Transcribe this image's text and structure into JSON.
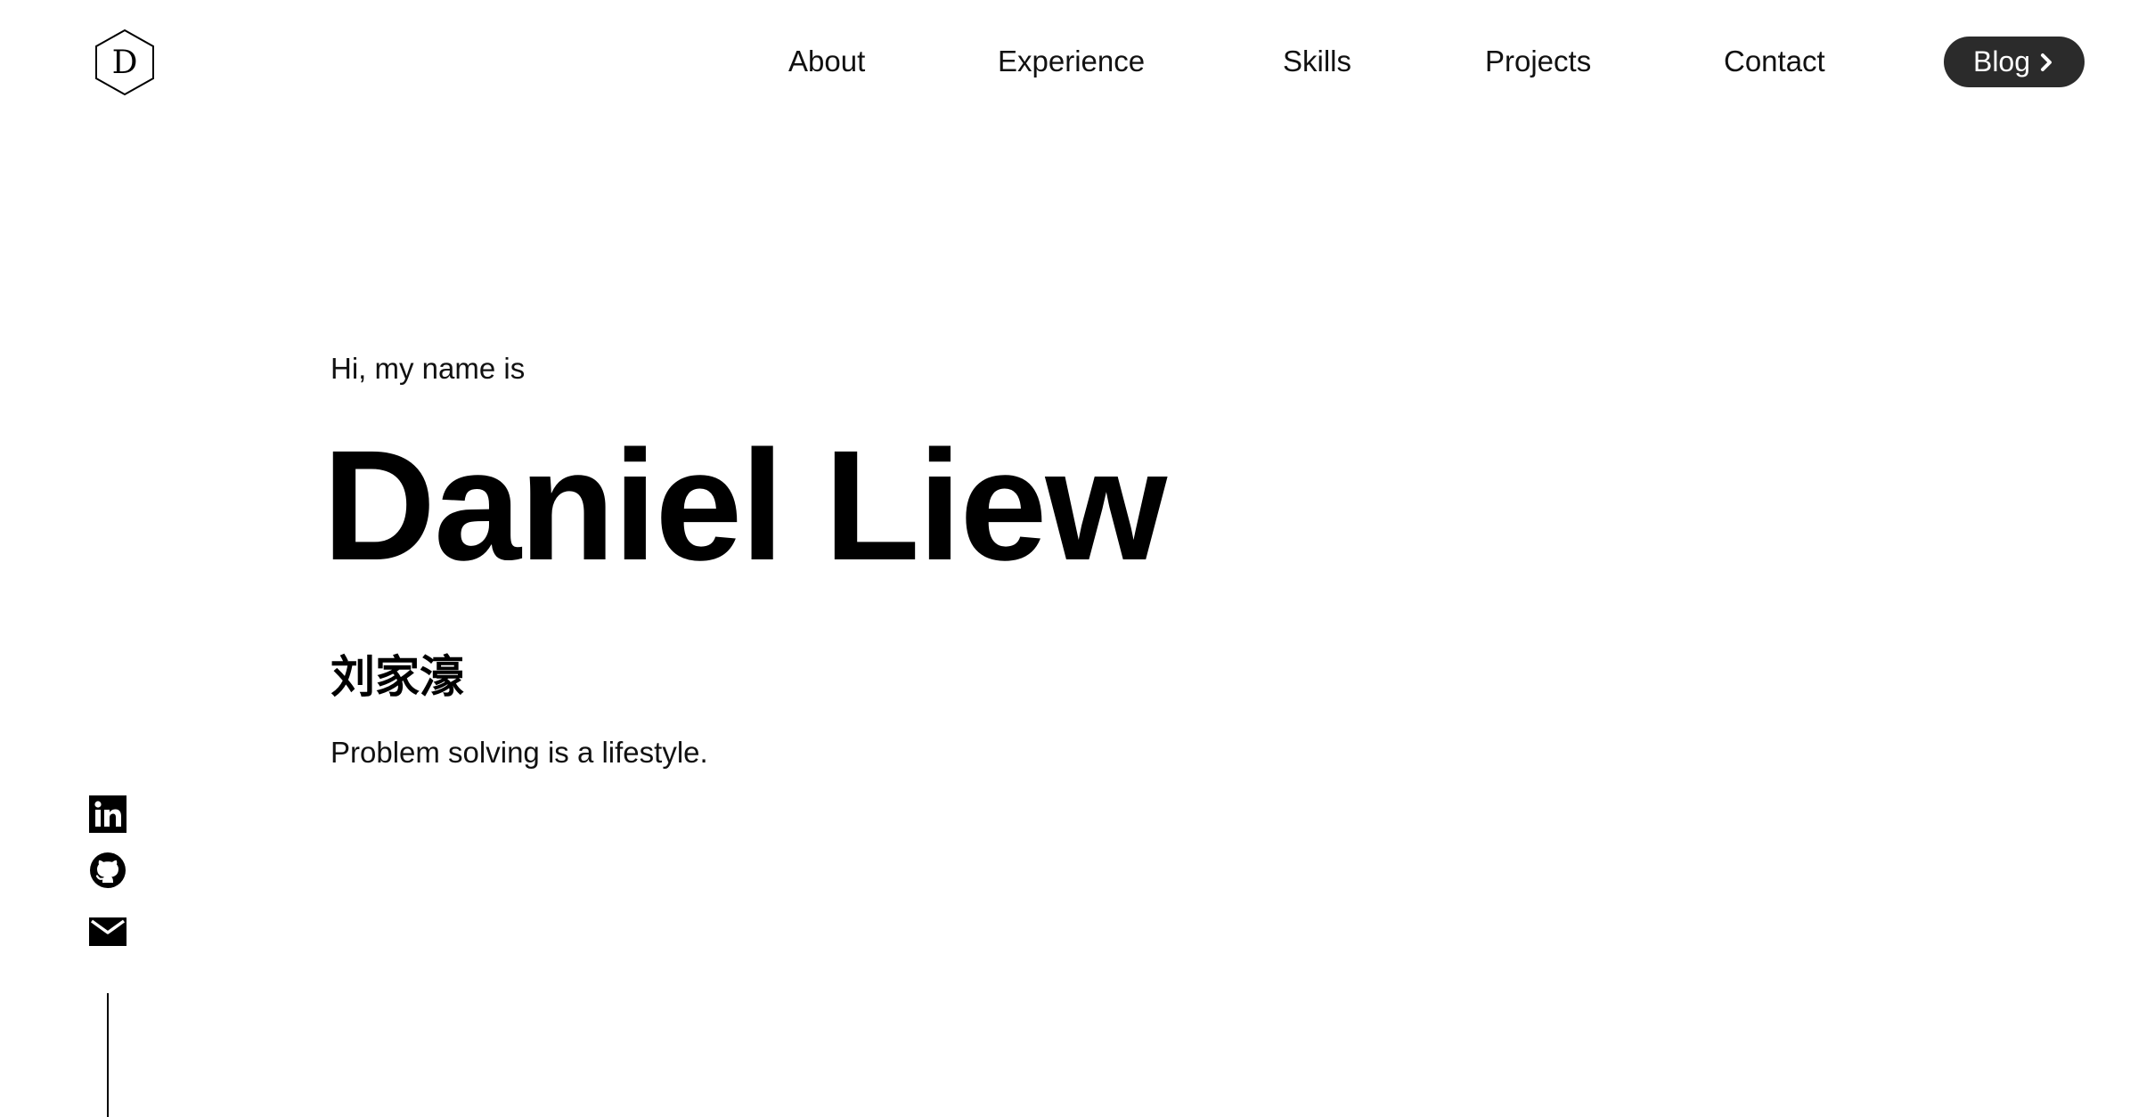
{
  "logo": {
    "letter": "D",
    "icon": "hexagon-logo-icon"
  },
  "nav": {
    "items": [
      {
        "label": "About"
      },
      {
        "label": "Experience"
      },
      {
        "label": "Skills"
      },
      {
        "label": "Projects"
      },
      {
        "label": "Contact"
      }
    ],
    "blog_label": "Blog",
    "blog_icon": "chevron-right-icon"
  },
  "hero": {
    "intro": "Hi, my name is",
    "name": "Daniel Liew",
    "chinese_name": "刘家濠",
    "tagline": "Problem solving is a lifestyle."
  },
  "social": {
    "icons": [
      "linkedin-icon",
      "github-icon",
      "mail-icon"
    ]
  },
  "colors": {
    "background": "#ffffff",
    "text": "#000000",
    "button": "#2b2b2b",
    "button_text": "#ffffff"
  }
}
